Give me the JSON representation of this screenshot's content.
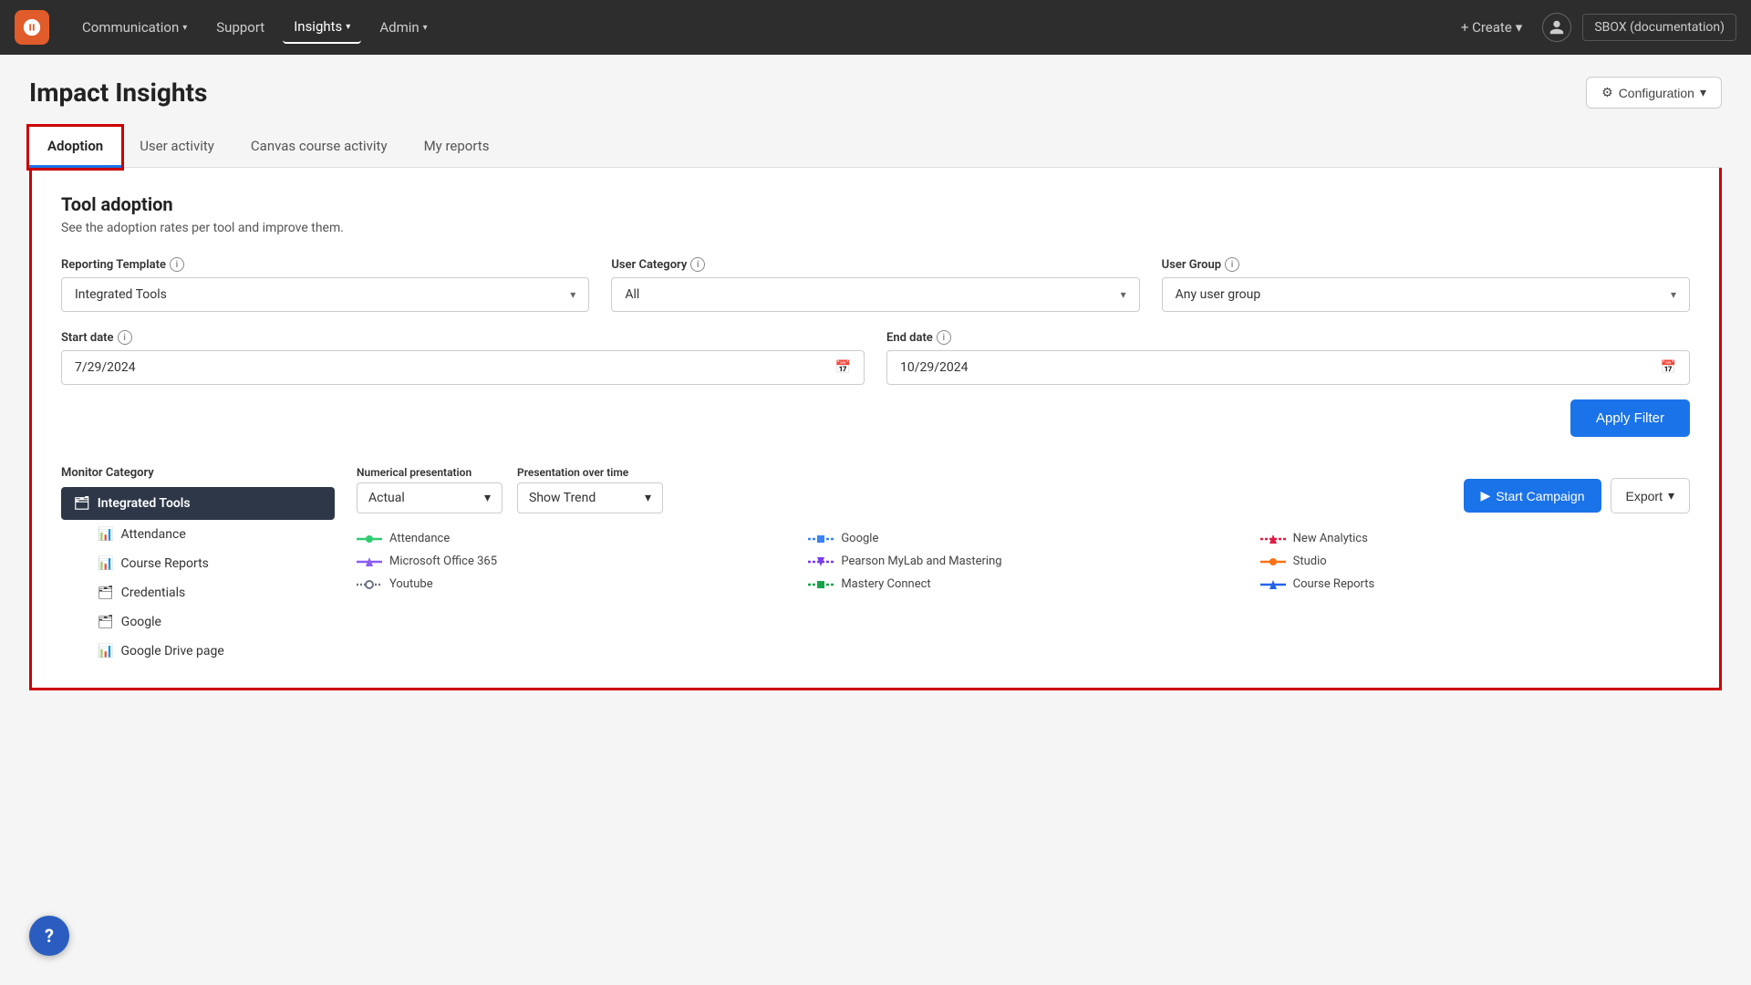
{
  "nav": {
    "logo_alt": "App Logo",
    "items": [
      {
        "label": "Communication",
        "hasDropdown": true,
        "active": false
      },
      {
        "label": "Support",
        "hasDropdown": false,
        "active": false
      },
      {
        "label": "Insights",
        "hasDropdown": true,
        "active": true
      },
      {
        "label": "Admin",
        "hasDropdown": true,
        "active": false
      }
    ],
    "create_label": "+ Create",
    "tenant_label": "SBOX (documentation)"
  },
  "page": {
    "title": "Impact Insights",
    "config_label": "Configuration"
  },
  "tabs": [
    {
      "label": "Adoption",
      "active": true
    },
    {
      "label": "User activity",
      "active": false
    },
    {
      "label": "Canvas course activity",
      "active": false
    },
    {
      "label": "My reports",
      "active": false
    }
  ],
  "tool_adoption": {
    "title": "Tool adoption",
    "description": "See the adoption rates per tool and improve them.",
    "filters": {
      "reporting_template": {
        "label": "Reporting Template",
        "value": "Integrated Tools",
        "options": [
          "Integrated Tools"
        ]
      },
      "user_category": {
        "label": "User Category",
        "value": "All",
        "options": [
          "All"
        ]
      },
      "user_group": {
        "label": "User Group",
        "value": "Any user group",
        "options": [
          "Any user group"
        ]
      }
    },
    "start_date": {
      "label": "Start date",
      "value": "7/29/2024"
    },
    "end_date": {
      "label": "End date",
      "value": "10/29/2024"
    },
    "apply_filter_label": "Apply Filter"
  },
  "monitor": {
    "label": "Monitor Category",
    "items": [
      {
        "label": "Integrated Tools",
        "active": true,
        "icon": "folder"
      },
      {
        "label": "Attendance",
        "active": false,
        "icon": "bar-chart"
      },
      {
        "label": "Course Reports",
        "active": false,
        "icon": "bar-chart"
      },
      {
        "label": "Credentials",
        "active": false,
        "icon": "folder"
      },
      {
        "label": "Google",
        "active": false,
        "icon": "folder"
      },
      {
        "label": "Google Drive page",
        "active": false,
        "icon": "bar-chart"
      }
    ]
  },
  "presentation": {
    "numerical_label": "Numerical presentation",
    "numerical_value": "Actual",
    "time_label": "Presentation over time",
    "time_value": "Show Trend",
    "start_campaign_label": "Start Campaign",
    "export_label": "Export"
  },
  "legend": {
    "items": [
      {
        "label": "Attendance",
        "color": "#2ecc71",
        "shape": "circle"
      },
      {
        "label": "Google",
        "color": "#3b82f6",
        "shape": "square"
      },
      {
        "label": "New Analytics",
        "color": "#e11d48",
        "shape": "diamond"
      },
      {
        "label": "Microsoft Office 365",
        "color": "#8b5cf6",
        "shape": "triangle"
      },
      {
        "label": "Pearson MyLab and Mastering",
        "color": "#7c3aed",
        "shape": "triangle-down"
      },
      {
        "label": "Studio",
        "color": "#f97316",
        "shape": "circle"
      },
      {
        "label": "Youtube",
        "color": "#6b7280",
        "shape": "circle-outline"
      },
      {
        "label": "Mastery Connect",
        "color": "#16a34a",
        "shape": "square"
      },
      {
        "label": "Course Reports",
        "color": "#2563eb",
        "shape": "diamond"
      }
    ]
  },
  "help": {
    "label": "?"
  }
}
